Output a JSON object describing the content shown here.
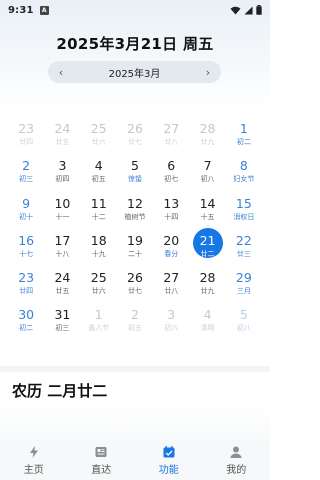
{
  "status_bar": {
    "time": "9:31",
    "badge": "A"
  },
  "header": {
    "date_title": "2025年3月21日 周五",
    "month_label": "2025年3月",
    "prev_arrow": "‹",
    "next_arrow": "›"
  },
  "calendar": {
    "weeks": [
      [
        {
          "day": "23",
          "lunar": "廿四",
          "dim": true,
          "weekend": false,
          "term": false
        },
        {
          "day": "24",
          "lunar": "廿五",
          "dim": true,
          "weekend": false,
          "term": false
        },
        {
          "day": "25",
          "lunar": "廿六",
          "dim": true,
          "weekend": false,
          "term": false
        },
        {
          "day": "26",
          "lunar": "廿七",
          "dim": true,
          "weekend": false,
          "term": false
        },
        {
          "day": "27",
          "lunar": "廿八",
          "dim": true,
          "weekend": false,
          "term": false
        },
        {
          "day": "28",
          "lunar": "廿九",
          "dim": true,
          "weekend": false,
          "term": false
        },
        {
          "day": "1",
          "lunar": "初二",
          "dim": false,
          "weekend": true,
          "term": false
        }
      ],
      [
        {
          "day": "2",
          "lunar": "初三",
          "dim": false,
          "weekend": true,
          "term": false
        },
        {
          "day": "3",
          "lunar": "初四",
          "dim": false,
          "weekend": false,
          "term": false
        },
        {
          "day": "4",
          "lunar": "初五",
          "dim": false,
          "weekend": false,
          "term": false
        },
        {
          "day": "5",
          "lunar": "惊蛰",
          "dim": false,
          "weekend": false,
          "term": true
        },
        {
          "day": "6",
          "lunar": "初七",
          "dim": false,
          "weekend": false,
          "term": false
        },
        {
          "day": "7",
          "lunar": "初八",
          "dim": false,
          "weekend": false,
          "term": false
        },
        {
          "day": "8",
          "lunar": "妇女节",
          "dim": false,
          "weekend": true,
          "term": false
        }
      ],
      [
        {
          "day": "9",
          "lunar": "初十",
          "dim": false,
          "weekend": true,
          "term": false
        },
        {
          "day": "10",
          "lunar": "十一",
          "dim": false,
          "weekend": false,
          "term": false
        },
        {
          "day": "11",
          "lunar": "十二",
          "dim": false,
          "weekend": false,
          "term": false
        },
        {
          "day": "12",
          "lunar": "植树节",
          "dim": false,
          "weekend": false,
          "term": false
        },
        {
          "day": "13",
          "lunar": "十四",
          "dim": false,
          "weekend": false,
          "term": false
        },
        {
          "day": "14",
          "lunar": "十五",
          "dim": false,
          "weekend": false,
          "term": false
        },
        {
          "day": "15",
          "lunar": "消权日",
          "dim": false,
          "weekend": true,
          "term": false
        }
      ],
      [
        {
          "day": "16",
          "lunar": "十七",
          "dim": false,
          "weekend": true,
          "term": false
        },
        {
          "day": "17",
          "lunar": "十八",
          "dim": false,
          "weekend": false,
          "term": false
        },
        {
          "day": "18",
          "lunar": "十九",
          "dim": false,
          "weekend": false,
          "term": false
        },
        {
          "day": "19",
          "lunar": "二十",
          "dim": false,
          "weekend": false,
          "term": false
        },
        {
          "day": "20",
          "lunar": "春分",
          "dim": false,
          "weekend": false,
          "term": true
        },
        {
          "day": "21",
          "lunar": "廿二",
          "dim": false,
          "weekend": false,
          "term": false,
          "selected": true
        },
        {
          "day": "22",
          "lunar": "廿三",
          "dim": false,
          "weekend": true,
          "term": false
        }
      ],
      [
        {
          "day": "23",
          "lunar": "廿四",
          "dim": false,
          "weekend": true,
          "term": false
        },
        {
          "day": "24",
          "lunar": "廿五",
          "dim": false,
          "weekend": false,
          "term": false
        },
        {
          "day": "25",
          "lunar": "廿六",
          "dim": false,
          "weekend": false,
          "term": false
        },
        {
          "day": "26",
          "lunar": "廿七",
          "dim": false,
          "weekend": false,
          "term": false
        },
        {
          "day": "27",
          "lunar": "廿八",
          "dim": false,
          "weekend": false,
          "term": false
        },
        {
          "day": "28",
          "lunar": "廿九",
          "dim": false,
          "weekend": false,
          "term": false
        },
        {
          "day": "29",
          "lunar": "三月",
          "dim": false,
          "weekend": true,
          "term": false
        }
      ],
      [
        {
          "day": "30",
          "lunar": "初二",
          "dim": false,
          "weekend": true,
          "term": false
        },
        {
          "day": "31",
          "lunar": "初三",
          "dim": false,
          "weekend": false,
          "term": false
        },
        {
          "day": "1",
          "lunar": "愚人节",
          "dim": true,
          "weekend": false,
          "term": false
        },
        {
          "day": "2",
          "lunar": "初五",
          "dim": true,
          "weekend": false,
          "term": false
        },
        {
          "day": "3",
          "lunar": "初六",
          "dim": true,
          "weekend": false,
          "term": false
        },
        {
          "day": "4",
          "lunar": "清明",
          "dim": true,
          "weekend": false,
          "term": false
        },
        {
          "day": "5",
          "lunar": "初八",
          "dim": true,
          "weekend": true,
          "term": false
        }
      ]
    ]
  },
  "lunar_panel": {
    "title": "农历 二月廿二"
  },
  "tabs": [
    {
      "label": "主页",
      "icon": "bolt-icon",
      "active": false
    },
    {
      "label": "直达",
      "icon": "news-icon",
      "active": false
    },
    {
      "label": "功能",
      "icon": "calendar-icon",
      "active": true
    },
    {
      "label": "我的",
      "icon": "person-icon",
      "active": false
    }
  ],
  "colors": {
    "accent": "#1677e6",
    "weekend": "#3b82d6",
    "dim": "#c8c8c8"
  }
}
